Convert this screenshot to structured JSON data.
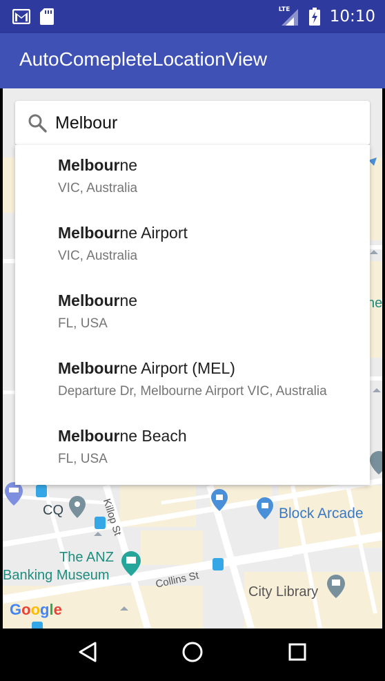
{
  "status_bar": {
    "time": "10:10",
    "network": "LTE",
    "icons": [
      "gmail-icon",
      "sd-card-icon",
      "signal-icon",
      "battery-charging-icon"
    ]
  },
  "app_bar": {
    "title": "AutoComepleteLocationView"
  },
  "search": {
    "value": "Melbour",
    "icon": "search-icon"
  },
  "suggestions": [
    {
      "match": "Melbour",
      "rest": "ne",
      "subtitle": "VIC, Australia"
    },
    {
      "match": "Melbour",
      "rest": "ne Airport",
      "subtitle": "VIC, Australia"
    },
    {
      "match": "Melbour",
      "rest": "ne",
      "subtitle": "FL, USA"
    },
    {
      "match": "Melbour",
      "rest": "ne Airport (MEL)",
      "subtitle": "Departure Dr, Melbourne Airport VIC, Australia"
    },
    {
      "match": "Melbour",
      "rest": "ne Beach",
      "subtitle": "FL, USA"
    }
  ],
  "map": {
    "labels": {
      "cq": "CQ",
      "block_arcade": "Block Arcade",
      "anz_line1": "The ANZ",
      "anz_line2": "Banking Museum",
      "city_library": "City Library",
      "collins_st": "Collins St",
      "killop_st": "Killop St",
      "google": "Google",
      "edge_partial": "ne"
    },
    "colors": {
      "poi_blue": "#4a90d9",
      "poi_teal": "#26a69a",
      "label_blue": "#3b78c4",
      "label_teal": "#1e8c7e"
    }
  },
  "nav": {
    "back": "back-icon",
    "home": "home-icon",
    "recents": "recents-icon"
  }
}
